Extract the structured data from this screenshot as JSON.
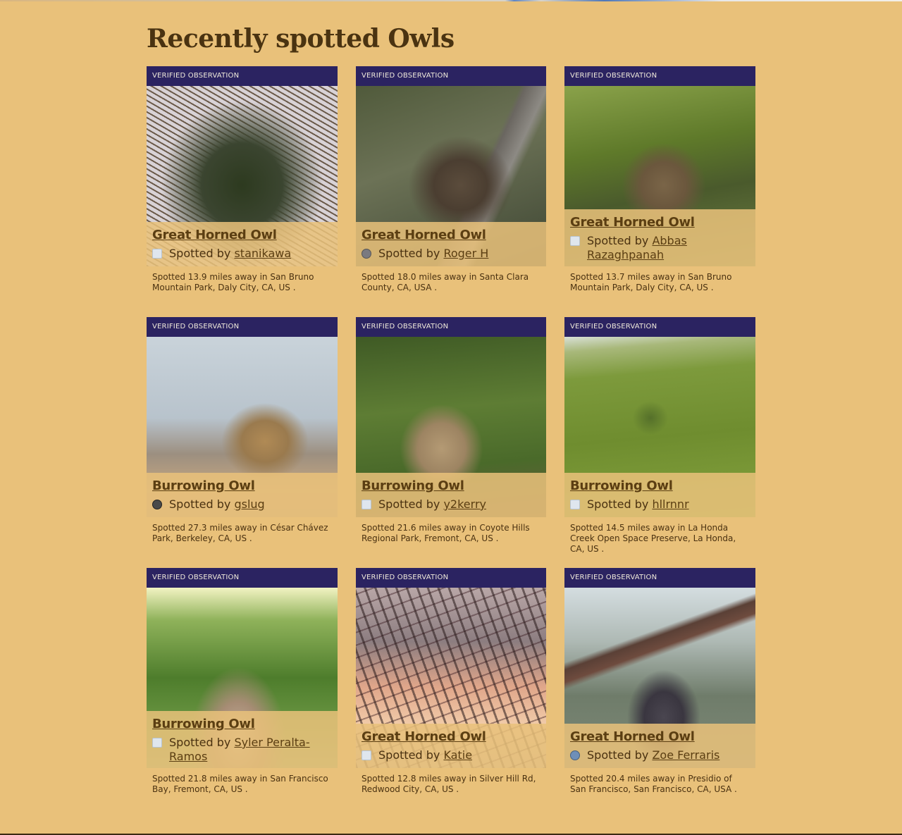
{
  "page": {
    "title": "Recently spotted Owls"
  },
  "cards": [
    {
      "badge": "VERIFIED OBSERVATION",
      "species": "Great Horned Owl",
      "by_label": "Spotted by ",
      "spotter": "stanikawa",
      "location": "Spotted  13.9 miles away  in San Bruno Mountain Park, Daly City, CA, US ."
    },
    {
      "badge": "VERIFIED OBSERVATION",
      "species": "Great Horned Owl",
      "by_label": "Spotted by ",
      "spotter": "Roger H",
      "location": "Spotted  18.0 miles away  in Santa Clara County, CA, USA ."
    },
    {
      "badge": "VERIFIED OBSERVATION",
      "species": "Great Horned Owl",
      "by_label": "Spotted by ",
      "spotter": "Abbas Razaghpanah",
      "location": "Spotted  13.7 miles away  in San Bruno Mountain Park, Daly City, CA, US ."
    },
    {
      "badge": "VERIFIED OBSERVATION",
      "species": "Burrowing Owl",
      "by_label": "Spotted by ",
      "spotter": "gslug",
      "location": "Spotted  27.3 miles away  in César Chávez Park, Berkeley, CA, US ."
    },
    {
      "badge": "VERIFIED OBSERVATION",
      "species": "Burrowing Owl",
      "by_label": "Spotted by ",
      "spotter": "y2kerry",
      "location": "Spotted  21.6 miles away  in Coyote Hills Regional Park, Fremont, CA, US ."
    },
    {
      "badge": "VERIFIED OBSERVATION",
      "species": "Burrowing Owl",
      "by_label": "Spotted by ",
      "spotter": "hllrnnr",
      "location": "Spotted  14.5 miles away  in La Honda Creek Open Space Preserve, La Honda, CA, US ."
    },
    {
      "badge": "VERIFIED OBSERVATION",
      "species": "Burrowing Owl",
      "by_label": "Spotted by ",
      "spotter": "Syler Peralta-Ramos",
      "location": "Spotted  21.8 miles away  in San Francisco Bay, Fremont, CA, US ."
    },
    {
      "badge": "VERIFIED OBSERVATION",
      "species": "Great Horned Owl",
      "by_label": "Spotted by ",
      "spotter": "Katie",
      "location": "Spotted  12.8 miles away  in Silver Hill Rd, Redwood City, CA, US ."
    },
    {
      "badge": "VERIFIED OBSERVATION",
      "species": "Great Horned Owl",
      "by_label": "Spotted by ",
      "spotter": "Zoe Ferraris",
      "location": "Spotted  20.4 miles away  in Presidio of San Francisco, San Francisco, CA, USA ."
    }
  ]
}
